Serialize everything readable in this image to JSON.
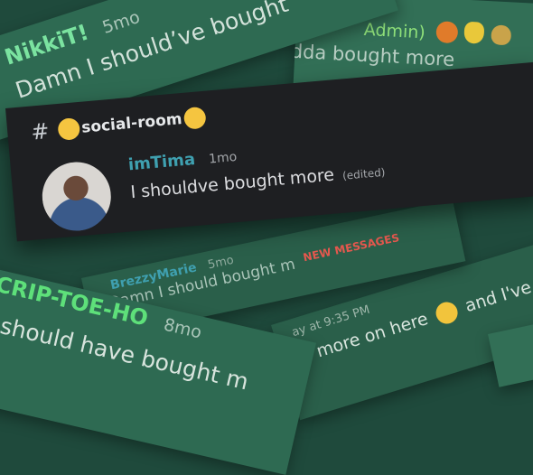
{
  "strip_top_left": {
    "username": "NikkiT!",
    "time": "5mo",
    "message": "Damn I should’ve bought"
  },
  "strip_top_right": {
    "username_fragment": "Admin)",
    "message_fragment": "udda bought more"
  },
  "main_card": {
    "channel_hash": "#",
    "channel_name": "social-room",
    "username": "imTima",
    "time": "1mo",
    "message": "I shouldve bought more",
    "edited_tag": "(edited)"
  },
  "strip_middle": {
    "username": "BrezzyMarie",
    "time": "5mo",
    "message": "Damn I should bought m",
    "divider_label": "NEW MESSAGES"
  },
  "strip_bottom_left": {
    "username": "CRIP-TOE-HO",
    "time": "8mo",
    "message": "I should have bought m"
  },
  "strip_bottom_right": {
    "timestamp": "ay at 9:35 PM",
    "message_a": "more on here",
    "message_b": "and I've to"
  },
  "colors": {
    "card_bg": "#1e1f22",
    "username_green": "#5ee07a",
    "username_teal": "#3fa0b0",
    "new_messages_red": "#e4584e"
  }
}
